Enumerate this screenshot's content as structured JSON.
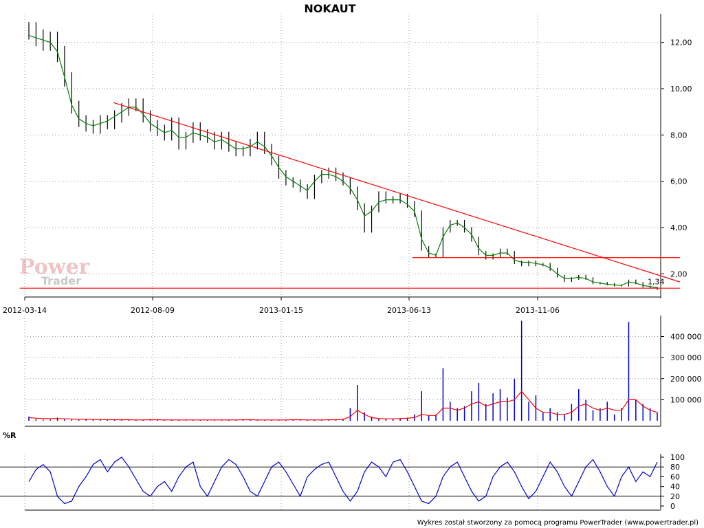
{
  "title": "NOKAUT",
  "footer": "Wykres został stworzony za pomocą programu PowerTrader (www.powertrader.pl)",
  "watermark": {
    "line1": "Power",
    "line2": "Trader"
  },
  "colors": {
    "price": "#000000",
    "ma": "#008000",
    "trend": "#ff0000",
    "volume": "#0000cc",
    "volume_ma": "#ff0000",
    "wr": "#0000cc",
    "grid": "#999999"
  },
  "chart_data": [
    {
      "name": "price",
      "type": "candlestick",
      "title": "NOKAUT",
      "x_ticks": [
        "2012-03-14",
        "2012-08-09",
        "2013-01-15",
        "2013-06-13",
        "2013-11-06"
      ],
      "y_ticks": [
        "2,00",
        "4,00",
        "6,00",
        "8,00",
        "10,00",
        "12,00"
      ],
      "ylim": [
        1.0,
        13.0
      ],
      "last_value_label": "1,34",
      "close": [
        12.5,
        12.2,
        12.0,
        12.1,
        11.5,
        10.4,
        9.2,
        8.6,
        8.4,
        8.3,
        8.6,
        8.5,
        8.8,
        9.1,
        9.3,
        9.3,
        8.8,
        8.4,
        8.2,
        8.0,
        8.5,
        7.6,
        7.9,
        8.3,
        8.0,
        7.9,
        7.6,
        7.9,
        7.5,
        7.3,
        7.3,
        7.6,
        7.9,
        7.4,
        6.9,
        6.3,
        6.0,
        5.9,
        5.7,
        5.4,
        6.1,
        6.3,
        6.4,
        6.2,
        6.0,
        5.6,
        4.9,
        3.9,
        4.8,
        5.4,
        5.2,
        5.2,
        5.3,
        5.0,
        4.6,
        3.1,
        2.8,
        2.8,
        3.9,
        4.2,
        4.2,
        3.9,
        3.5,
        2.9,
        2.7,
        2.8,
        3.0,
        2.9,
        2.5,
        2.4,
        2.5,
        2.4,
        2.4,
        2.2,
        1.9,
        1.7,
        1.8,
        1.9,
        1.8,
        1.6,
        1.6,
        1.55,
        1.5,
        1.5,
        1.7,
        1.6,
        1.45,
        1.4,
        1.34
      ],
      "ma": [
        12.3,
        12.2,
        12.1,
        12.0,
        11.6,
        10.5,
        9.3,
        8.7,
        8.5,
        8.4,
        8.5,
        8.6,
        8.8,
        9.0,
        9.2,
        9.2,
        8.9,
        8.5,
        8.3,
        8.1,
        8.2,
        7.9,
        7.9,
        8.1,
        8.0,
        7.9,
        7.7,
        7.8,
        7.6,
        7.4,
        7.4,
        7.5,
        7.7,
        7.5,
        7.1,
        6.6,
        6.2,
        6.0,
        5.8,
        5.6,
        6.0,
        6.3,
        6.3,
        6.2,
        6.0,
        5.7,
        5.2,
        4.5,
        4.7,
        5.1,
        5.2,
        5.2,
        5.2,
        5.0,
        4.7,
        3.5,
        2.9,
        2.8,
        3.6,
        4.1,
        4.2,
        4.0,
        3.7,
        3.1,
        2.8,
        2.8,
        2.9,
        2.9,
        2.6,
        2.5,
        2.5,
        2.45,
        2.4,
        2.25,
        2.0,
        1.8,
        1.8,
        1.85,
        1.8,
        1.65,
        1.6,
        1.55,
        1.52,
        1.5,
        1.65,
        1.6,
        1.5,
        1.45,
        1.4
      ],
      "trendlines": [
        {
          "from": [
            "2012-06-26",
            9.4
          ],
          "to": [
            "2014-04-22",
            1.65
          ]
        },
        {
          "from": [
            "2013-06-12",
            2.7
          ],
          "to": [
            "2014-04-22",
            2.7
          ]
        },
        {
          "from": [
            "2012-03-08",
            1.38
          ],
          "to": [
            "2014-04-22",
            1.38
          ]
        }
      ]
    },
    {
      "name": "volume",
      "type": "bar",
      "y_ticks": [
        "100 000",
        "200 000",
        "300 000",
        "400 000"
      ],
      "ylim": [
        0,
        480000
      ],
      "values": [
        20000,
        8000,
        5000,
        6000,
        15000,
        8000,
        5000,
        4000,
        6000,
        5000,
        5000,
        4000,
        6000,
        5000,
        4000,
        3000,
        5000,
        6000,
        4000,
        3000,
        5000,
        4000,
        3000,
        4000,
        3000,
        5000,
        4000,
        3000,
        3000,
        4000,
        6000,
        4000,
        3000,
        5000,
        4000,
        4000,
        5000,
        6000,
        4000,
        3000,
        4000,
        5000,
        6000,
        5000,
        10000,
        60000,
        170000,
        40000,
        20000,
        10000,
        8000,
        10000,
        12000,
        15000,
        30000,
        140000,
        25000,
        30000,
        250000,
        90000,
        60000,
        70000,
        140000,
        180000,
        80000,
        130000,
        150000,
        110000,
        200000,
        475000,
        90000,
        120000,
        40000,
        60000,
        40000,
        30000,
        80000,
        150000,
        100000,
        50000,
        60000,
        90000,
        30000,
        60000,
        470000,
        100000,
        80000,
        60000,
        40000
      ],
      "ma": [
        15000,
        12000,
        10000,
        10000,
        10000,
        9000,
        8000,
        7000,
        7000,
        6000,
        6000,
        5000,
        5000,
        5000,
        5000,
        4000,
        4000,
        5000,
        5000,
        4000,
        4000,
        4000,
        4000,
        4000,
        4000,
        4000,
        4000,
        4000,
        4000,
        4000,
        5000,
        5000,
        4000,
        4000,
        4000,
        4000,
        4000,
        5000,
        5000,
        4000,
        4000,
        4000,
        5000,
        5000,
        6000,
        20000,
        50000,
        30000,
        15000,
        10000,
        9000,
        9000,
        10000,
        12000,
        15000,
        30000,
        25000,
        25000,
        60000,
        60000,
        50000,
        60000,
        80000,
        90000,
        70000,
        80000,
        90000,
        90000,
        100000,
        140000,
        100000,
        60000,
        40000,
        40000,
        30000,
        30000,
        40000,
        70000,
        80000,
        60000,
        50000,
        60000,
        50000,
        50000,
        100000,
        100000,
        70000,
        50000,
        40000
      ]
    },
    {
      "name": "%R",
      "type": "line",
      "title": "%R",
      "y_ticks": [
        "0",
        "20",
        "40",
        "60",
        "80",
        "100"
      ],
      "ylim": [
        0,
        100
      ],
      "reference_lines": [
        20,
        80
      ],
      "values": [
        50,
        75,
        85,
        70,
        20,
        5,
        10,
        40,
        60,
        85,
        95,
        70,
        90,
        100,
        80,
        55,
        30,
        20,
        40,
        50,
        30,
        60,
        80,
        90,
        40,
        20,
        50,
        80,
        95,
        85,
        60,
        30,
        20,
        50,
        80,
        90,
        70,
        45,
        20,
        60,
        75,
        85,
        90,
        60,
        30,
        10,
        30,
        70,
        90,
        80,
        60,
        90,
        95,
        70,
        40,
        10,
        5,
        20,
        60,
        80,
        90,
        60,
        30,
        10,
        20,
        60,
        80,
        90,
        70,
        40,
        15,
        30,
        60,
        90,
        70,
        40,
        20,
        50,
        80,
        95,
        70,
        40,
        20,
        60,
        80,
        50,
        70,
        60,
        90
      ]
    }
  ]
}
